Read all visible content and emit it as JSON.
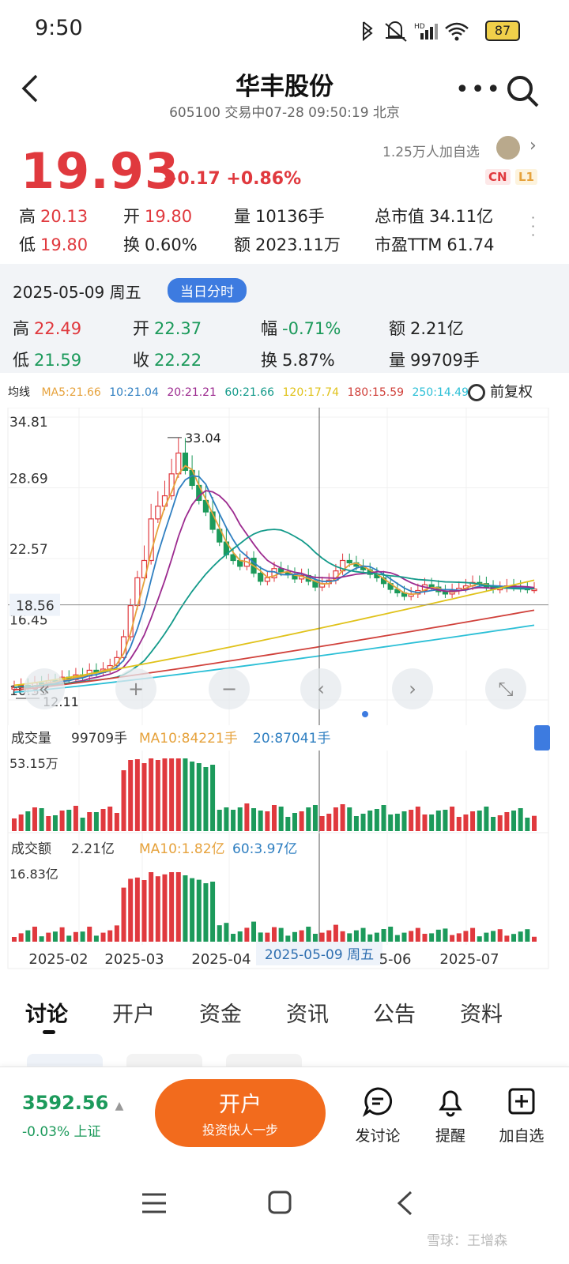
{
  "status_bar": {
    "time": "9:50",
    "battery": "87"
  },
  "header": {
    "title": "华丰股份",
    "subtitle": "605100 交易中07-28 09:50:19 北京"
  },
  "quote": {
    "price": "19.93",
    "change": "+0.17",
    "change_pct": "+0.86%",
    "followers": "1.25万人加自选",
    "badge_cn": "CN",
    "badge_l1": "L1",
    "high_label": "高",
    "high": "20.13",
    "open_label": "开",
    "open": "19.80",
    "volume_label": "量",
    "volume": "10136手",
    "mcap_label": "总市值",
    "mcap": "34.11亿",
    "low_label": "低",
    "low": "19.80",
    "turnover_label": "换",
    "turnover": "0.60%",
    "amount_label": "额",
    "amount": "2023.11万",
    "pe_label": "市盈TTM",
    "pe": "61.74"
  },
  "day_panel": {
    "date": "2025-05-09 周五",
    "button": "当日分时",
    "high_label": "高",
    "high": "22.49",
    "open_label": "开",
    "open": "22.37",
    "amp_label": "幅",
    "amp": "-0.71%",
    "amount_label": "额",
    "amount": "2.21亿",
    "low_label": "低",
    "low": "21.59",
    "close_label": "收",
    "close": "22.22",
    "turnover_label": "换",
    "turnover": "5.87%",
    "volume_label": "量",
    "volume": "99709手"
  },
  "ma_legend": {
    "label": "均线",
    "items": [
      {
        "text": "MA5:21.66",
        "color": "#e6a23c"
      },
      {
        "text": "10:21.04",
        "color": "#2f7fc1"
      },
      {
        "text": "20:21.21",
        "color": "#9c2a8f"
      },
      {
        "text": "60:21.66",
        "color": "#139a8a"
      },
      {
        "text": "120:17.74",
        "color": "#e0c21a"
      },
      {
        "text": "180:15.59",
        "color": "#d0403a"
      },
      {
        "text": "250:14.49",
        "color": "#2bbfd6"
      }
    ],
    "adjust": "前复权"
  },
  "colors": {
    "up": "#e0393e",
    "down": "#1c9a5b",
    "accent": "#3d7be0",
    "orange": "#f26b1d"
  },
  "chart_data": [
    {
      "type": "candlestick",
      "name": "price",
      "ylim": [
        10.33,
        34.81
      ],
      "y_ticks": [
        "34.81",
        "28.69",
        "22.57",
        "16.45",
        "10.33"
      ],
      "crosshair_value": "18.56",
      "max_marker": "33.04",
      "min_marker": "12.11",
      "x_ticks": [
        "2025-02",
        "2025-03",
        "2025-04",
        "2025-05-09 周五",
        "5-06",
        "2025-07"
      ],
      "closes": [
        11.4,
        11.6,
        11.3,
        11.8,
        11.7,
        12.0,
        11.9,
        12.3,
        12.1,
        12.5,
        12.4,
        12.9,
        12.7,
        13.0,
        13.3,
        14.0,
        15.8,
        18.5,
        20.9,
        22.4,
        26.0,
        27.1,
        28.0,
        29.9,
        31.7,
        30.2,
        28.9,
        27.6,
        26.6,
        25.1,
        24.0,
        22.9,
        22.4,
        21.9,
        22.6,
        21.3,
        20.6,
        20.9,
        21.7,
        21.4,
        21.2,
        20.8,
        21.1,
        20.6,
        20.1,
        20.4,
        20.7,
        21.5,
        22.4,
        22.2,
        21.9,
        21.6,
        21.2,
        20.9,
        20.4,
        19.9,
        19.6,
        19.3,
        19.5,
        19.8,
        20.3,
        20.1,
        19.7,
        19.5,
        19.8,
        20.0,
        20.2,
        20.5,
        20.4,
        20.1,
        19.9,
        20.0,
        20.2,
        20.1,
        20.0,
        19.9,
        19.93
      ]
    },
    {
      "type": "bar",
      "name": "成交量",
      "label": "成交量",
      "value": "99709手",
      "ma10": "MA10:84221手",
      "ma20": "20:87041手",
      "y_max_label": "53.15万"
    },
    {
      "type": "bar",
      "name": "成交额",
      "label": "成交额",
      "value": "2.21亿",
      "ma10": "MA10:1.82亿",
      "ma60": "60:3.97亿",
      "y_max_label": "16.83亿"
    }
  ],
  "tabs": [
    "讨论",
    "开户",
    "资金",
    "资讯",
    "公告",
    "资料"
  ],
  "bottom": {
    "index_value": "3592.56",
    "index_change": "-0.03% 上证",
    "open_account": "开户",
    "open_account_sub": "投资快人一步",
    "discuss": "发讨论",
    "remind": "提醒",
    "add": "加自选"
  },
  "watermark": "雪球：王增森"
}
